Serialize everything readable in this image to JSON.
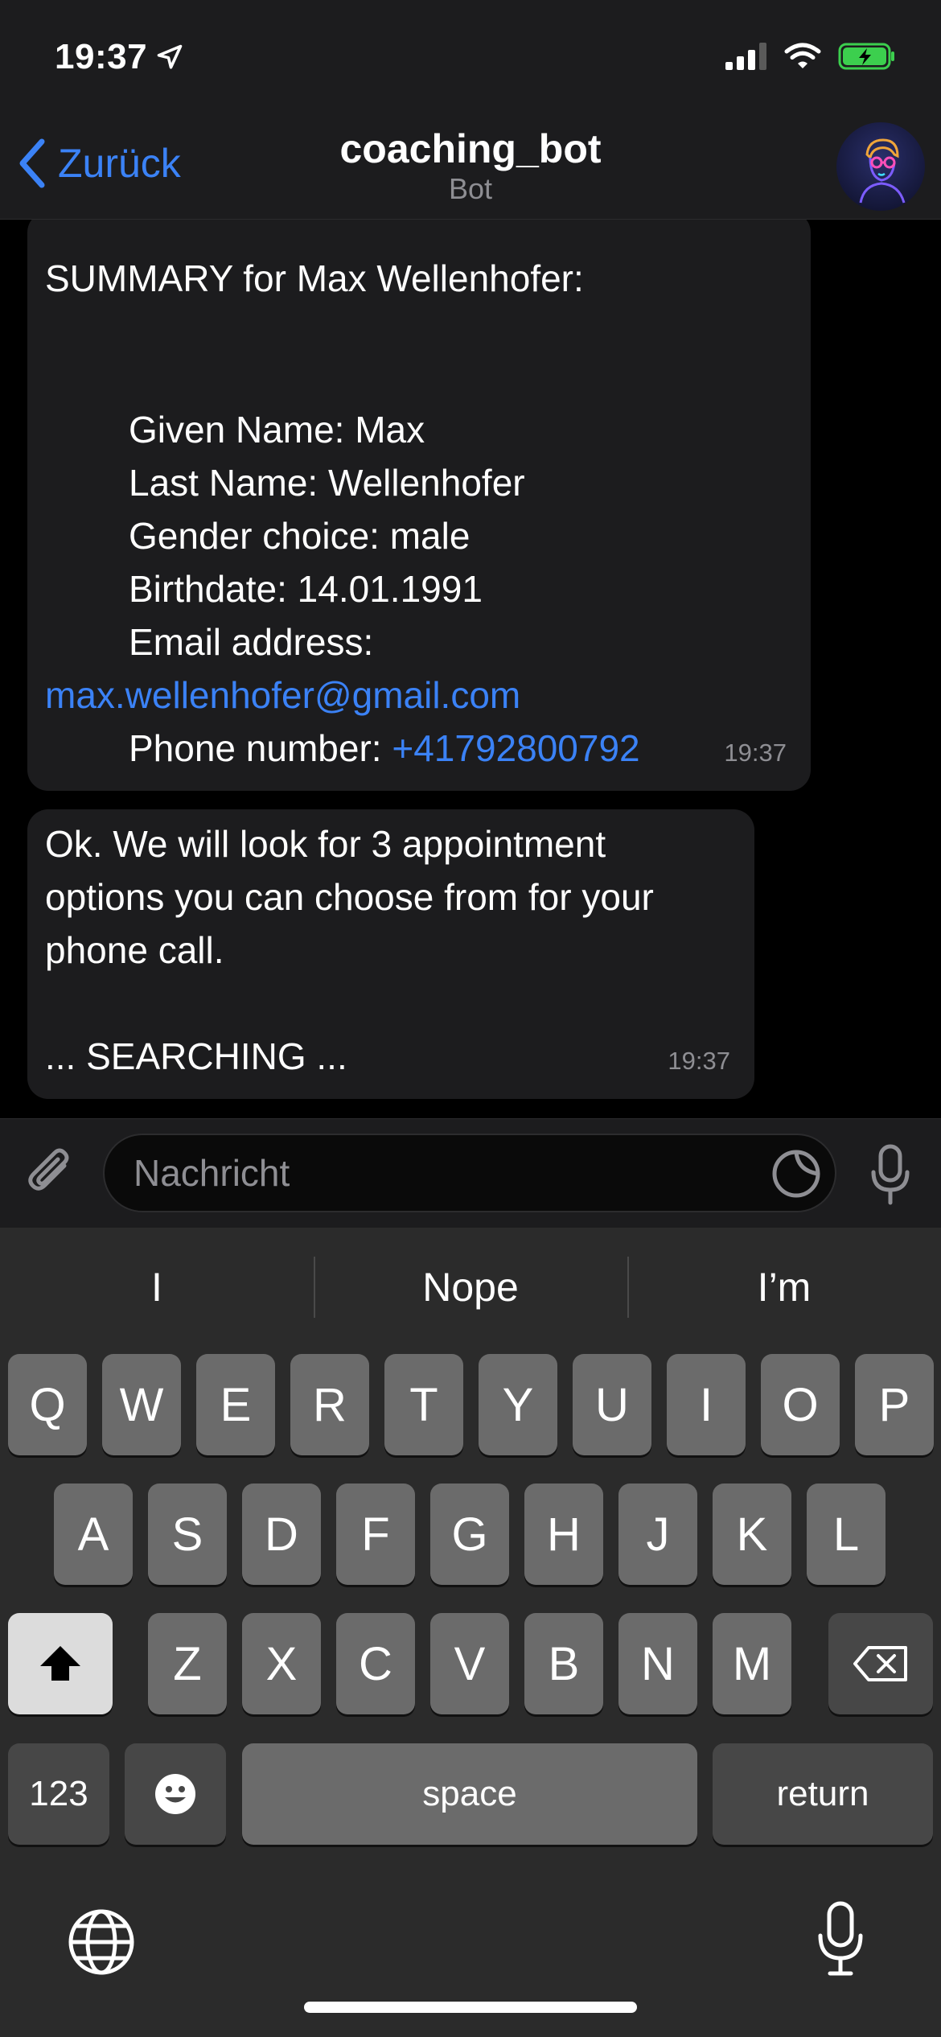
{
  "status_bar": {
    "time": "19:37"
  },
  "nav": {
    "back_label": "Zurück",
    "title": "coaching_bot",
    "subtitle": "Bot"
  },
  "messages": [
    {
      "lines": [
        "SUMMARY for Max Wellenhofer:",
        "Given Name:  Max",
        "Last Name:  Wellenhofer",
        "Gender choice:  male",
        "Birthdate:   14.01.1991",
        "Email address:",
        "max.wellenhofer@gmail.com",
        "Phone number: ",
        "+41792800792"
      ],
      "time": "19:37"
    },
    {
      "lines": [
        "Ok. We will look for 3 appointment",
        "options you can choose from for your",
        "phone call.",
        "... SEARCHING ..."
      ],
      "time": "19:37"
    }
  ],
  "composer": {
    "placeholder": "Nachricht"
  },
  "keyboard": {
    "suggestions": [
      "I",
      "Nope",
      "I’m"
    ],
    "row1": [
      "Q",
      "W",
      "E",
      "R",
      "T",
      "Y",
      "U",
      "I",
      "O",
      "P"
    ],
    "row2": [
      "A",
      "S",
      "D",
      "F",
      "G",
      "H",
      "J",
      "K",
      "L"
    ],
    "row3": [
      "Z",
      "X",
      "C",
      "V",
      "B",
      "N",
      "M"
    ],
    "numbers_label": "123",
    "space_label": "space",
    "return_label": "return"
  },
  "colors": {
    "accent": "#3b82f6",
    "bubble": "#1c1c1e",
    "keyboard_bg": "#2b2b2b"
  },
  "icons": [
    "location-arrow-icon",
    "signal-icon",
    "wifi-icon",
    "battery-charging-icon",
    "chevron-left-icon",
    "paperclip-icon",
    "sticker-icon",
    "microphone-icon",
    "shift-icon",
    "backspace-icon",
    "emoji-icon",
    "globe-icon"
  ]
}
